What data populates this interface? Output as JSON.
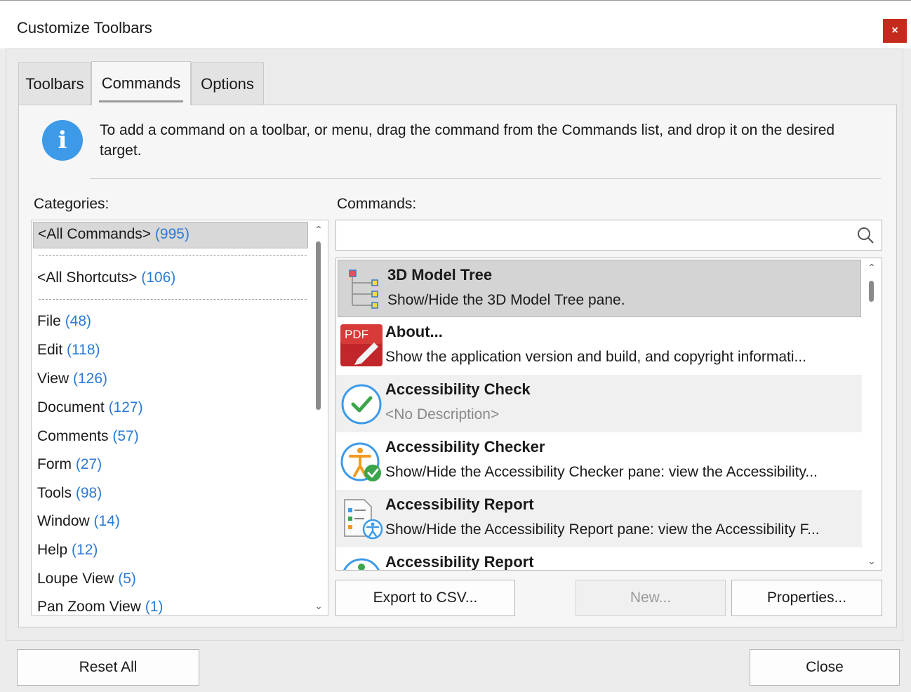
{
  "window": {
    "title": "Customize Toolbars",
    "close_glyph": "×"
  },
  "tabs": [
    {
      "label": "Toolbars"
    },
    {
      "label": "Commands"
    },
    {
      "label": "Options"
    }
  ],
  "info": {
    "icon": "info-icon",
    "text": "To add a command on a toolbar, or menu, drag the command from the Commands list, and drop it on the desired target."
  },
  "categories": {
    "label": "Categories:",
    "items": [
      {
        "name": "<All Commands>",
        "count": "(995)"
      },
      {
        "name": "<All Shortcuts>",
        "count": "(106)"
      },
      {
        "name": "File",
        "count": "(48)"
      },
      {
        "name": "Edit",
        "count": "(118)"
      },
      {
        "name": "View",
        "count": "(126)"
      },
      {
        "name": "Document",
        "count": "(127)"
      },
      {
        "name": "Comments",
        "count": "(57)"
      },
      {
        "name": "Form",
        "count": "(27)"
      },
      {
        "name": "Tools",
        "count": "(98)"
      },
      {
        "name": "Window",
        "count": "(14)"
      },
      {
        "name": "Help",
        "count": "(12)"
      },
      {
        "name": "Loupe View",
        "count": "(5)"
      },
      {
        "name": "Pan Zoom View",
        "count": "(1)"
      }
    ]
  },
  "commands": {
    "label": "Commands:",
    "search_value": "",
    "items": [
      {
        "name": "3D Model Tree",
        "description": "Show/Hide the 3D Model Tree pane.",
        "icon": "model-tree-icon"
      },
      {
        "name": "About...",
        "description": "Show the application version and build, and copyright informati...",
        "icon": "pdf-about-icon",
        "icon_text": "PDF"
      },
      {
        "name": "Accessibility Check",
        "description": "<No Description>",
        "icon": "check-circle-icon"
      },
      {
        "name": "Accessibility Checker",
        "description": "Show/Hide the Accessibility Checker pane: view the Accessibility...",
        "icon": "accessibility-checker-icon"
      },
      {
        "name": "Accessibility Report",
        "description": "Show/Hide the Accessibility Report pane: view the Accessibility F...",
        "icon": "accessibility-report-icon"
      },
      {
        "name": "Accessibility Report",
        "description": "",
        "icon": "accessibility-person-icon"
      }
    ]
  },
  "buttons": {
    "export_csv": "Export to CSV...",
    "new": "New...",
    "properties": "Properties...",
    "reset_all": "Reset All",
    "close": "Close"
  },
  "colors": {
    "accent_link": "#2a7ad6",
    "info_blue": "#3d9ae8",
    "close_red": "#c42b1c"
  }
}
